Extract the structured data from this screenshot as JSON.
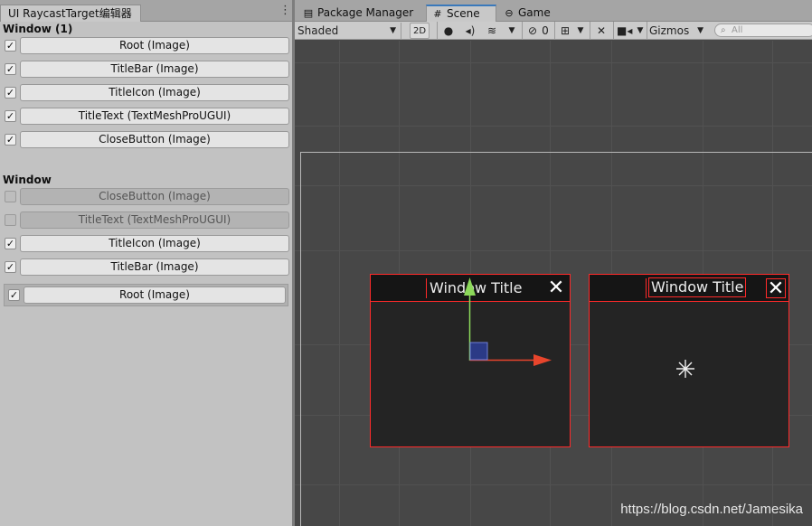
{
  "left_panel": {
    "tab_title": "UI RaycastTarget编辑器",
    "menu_icon": "kebab-icon",
    "groups": [
      {
        "title": "Window (1)",
        "rows": [
          {
            "checked": true,
            "label": "Root (Image)"
          },
          {
            "checked": true,
            "label": "TitleBar (Image)"
          },
          {
            "checked": true,
            "label": "TitleIcon (Image)"
          },
          {
            "checked": true,
            "label": "TitleText (TextMeshProUGUI)"
          },
          {
            "checked": true,
            "label": "CloseButton (Image)"
          }
        ]
      },
      {
        "title": "Window",
        "rows": [
          {
            "checked": false,
            "label": "CloseButton (Image)"
          },
          {
            "checked": false,
            "label": "TitleText (TextMeshProUGUI)"
          },
          {
            "checked": true,
            "label": "TitleIcon (Image)"
          },
          {
            "checked": true,
            "label": "TitleBar (Image)"
          },
          {
            "checked": true,
            "label": "Root (Image)"
          }
        ]
      }
    ]
  },
  "right_panel": {
    "tabs": [
      {
        "label": "Package Manager",
        "icon": "package-icon",
        "active": false
      },
      {
        "label": "Scene",
        "icon": "grid-icon",
        "active": true
      },
      {
        "label": "Game",
        "icon": "gamepad-icon",
        "active": false
      }
    ],
    "toolbar": {
      "shading_mode": "Shaded",
      "mode_2d": "2D",
      "hidden_count": "0",
      "gizmos_label": "Gizmos",
      "search_placeholder": "All"
    },
    "scene": {
      "windows": [
        {
          "title": "Window Title",
          "close_glyph": "✕"
        },
        {
          "title": "Window Title",
          "close_glyph": "✕"
        }
      ]
    }
  },
  "watermark": "https://blog.csdn.net/Jamesika",
  "colors": {
    "selection_outline": "#ff2a2a",
    "scene_background": "#474747",
    "active_tab_accent": "#3a79bb"
  }
}
